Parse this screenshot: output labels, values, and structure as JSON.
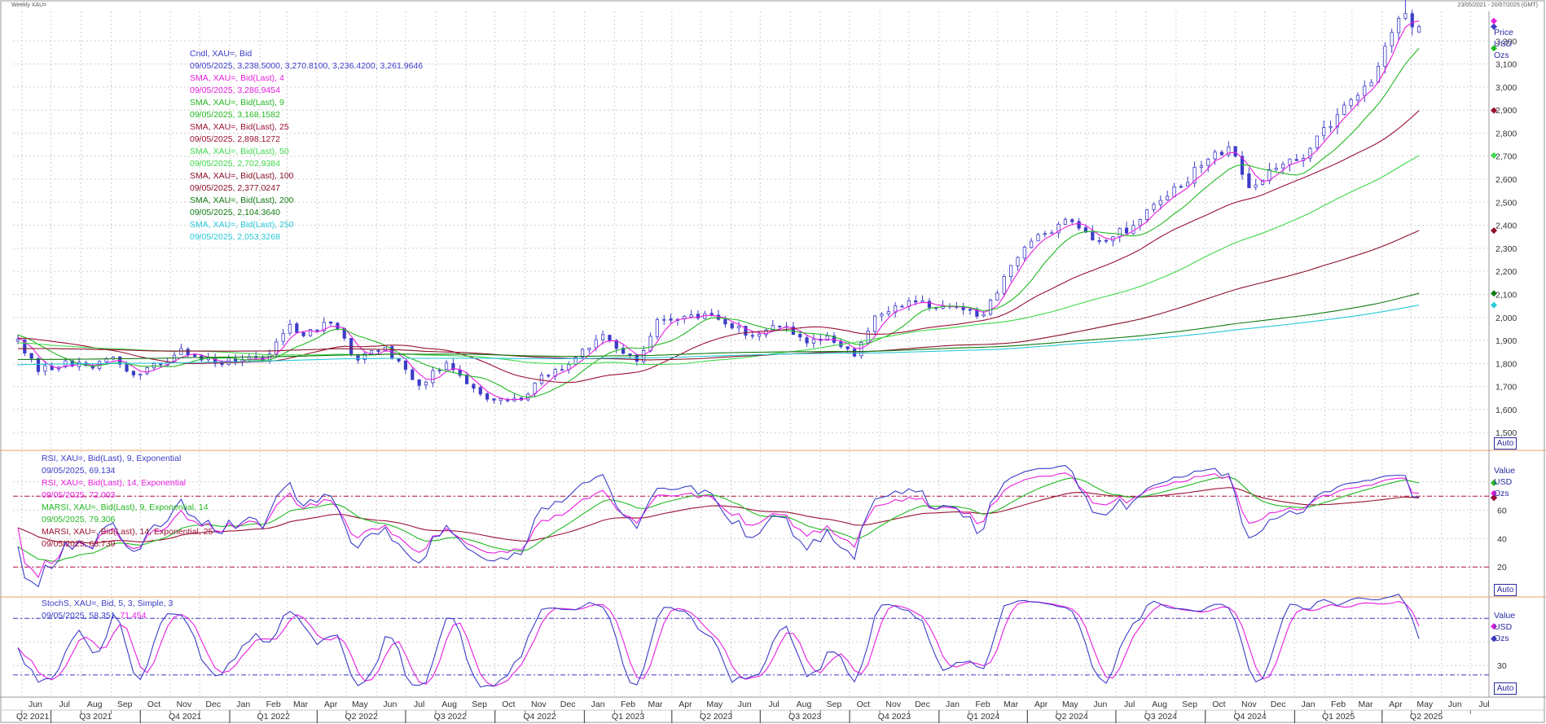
{
  "header": {
    "title": "Weekly XAU=",
    "range": "23/05/2021 - 20/07/2025 (GMT)"
  },
  "price_legend": [
    {
      "text": "Cndl, XAU=, Bid",
      "color": "#3c3cc8"
    },
    {
      "text": "09/05/2025, 3,238.5000, 3,270.8100, 3,236.4200, 3,261.9646",
      "color": "#3c3cc8"
    },
    {
      "text": "SMA, XAU=, Bid(Last),  4",
      "color": "#e81ee0"
    },
    {
      "text": "09/05/2025, 3,286.9454",
      "color": "#e81ee0"
    },
    {
      "text": "SMA, XAU=, Bid(Last),  9",
      "color": "#22b922"
    },
    {
      "text": "09/05/2025, 3,168.1582",
      "color": "#22b922"
    },
    {
      "text": "SMA, XAU=, Bid(Last),  25",
      "color": "#9a1232"
    },
    {
      "text": "09/05/2025, 2,898.1272",
      "color": "#9a1232"
    },
    {
      "text": "SMA, XAU=, Bid(Last),  50",
      "color": "#3fd84a"
    },
    {
      "text": "09/05/2025, 2,702.9384",
      "color": "#3fd84a"
    },
    {
      "text": "SMA, XAU=, Bid(Last),  100",
      "color": "#8a0f28"
    },
    {
      "text": "09/05/2025, 2,377.0247",
      "color": "#8a0f28"
    },
    {
      "text": "SMA, XAU=, Bid(Last),  200",
      "color": "#117a11"
    },
    {
      "text": "09/05/2025, 2,104.3640",
      "color": "#117a11"
    },
    {
      "text": "SMA, XAU=, Bid(Last),  250",
      "color": "#27c8d8"
    },
    {
      "text": "09/05/2025, 2,053.3268",
      "color": "#27c8d8"
    }
  ],
  "rsi_legend": [
    {
      "text": "RSI, XAU=, Bid(Last),  9, Exponential",
      "color": "#3c3cc8"
    },
    {
      "text": "09/05/2025, 69.134",
      "color": "#3c3cc8"
    },
    {
      "text": "RSI, XAU=, Bid(Last),  14, Exponential",
      "color": "#e81ee0"
    },
    {
      "text": "09/05/2025, 72.003",
      "color": "#e81ee0"
    },
    {
      "text": "MARSI, XAU=, Bid(Last),  9, Exponential, 14",
      "color": "#22b922"
    },
    {
      "text": "09/05/2025, 79.306",
      "color": "#22b922"
    },
    {
      "text": "MARSI, XAU=, Bid(Last),  14, Exponential, 25",
      "color": "#9a1232"
    },
    {
      "text": "09/05/2025, 68.739",
      "color": "#9a1232"
    }
  ],
  "stoch_legend": [
    {
      "text": "StochS, XAU=, Bid,  5, 3, Simple, 3",
      "color": "#3c3cc8"
    },
    {
      "text_a": "09/05/2025, 58.351,",
      "text_b": " 71.454",
      "color_a": "#3c3cc8",
      "color_b": "#e81ee0"
    }
  ],
  "price_axis": {
    "title_lines": [
      "Price",
      "USD",
      "Ozs"
    ],
    "auto": "Auto",
    "ticks": [
      "1,500",
      "1,600",
      "1,700",
      "1,800",
      "1,900",
      "2,000",
      "2,100",
      "2,200",
      "2,300",
      "2,400",
      "2,500",
      "2,600",
      "2,700",
      "2,800",
      "2,900",
      "3,000",
      "3,100",
      "3,200"
    ]
  },
  "rsi_axis": {
    "title_lines": [
      "Value",
      "USD",
      "Ozs"
    ],
    "auto": "Auto",
    "ticks": [
      "20",
      "40",
      "60"
    ]
  },
  "stoch_axis": {
    "title_lines": [
      "Value",
      "USD",
      "Ozs"
    ],
    "auto": "Auto",
    "ticks": [
      "30"
    ]
  },
  "time_axis": {
    "months": [
      "Jun",
      "Jul",
      "Aug",
      "Sep",
      "Oct",
      "Nov",
      "Dec",
      "Jan",
      "Feb",
      "Mar",
      "Apr",
      "May",
      "Jun",
      "Jul",
      "Aug",
      "Sep",
      "Oct",
      "Nov",
      "Dec",
      "Jan",
      "Feb",
      "Mar",
      "Apr",
      "May",
      "Jun",
      "Jul",
      "Aug",
      "Sep",
      "Oct",
      "Nov",
      "Dec",
      "Jan",
      "Feb",
      "Mar",
      "Apr",
      "May",
      "Jun",
      "Jul",
      "Aug",
      "Sep",
      "Oct",
      "Nov",
      "Dec",
      "Jan",
      "Feb",
      "Mar",
      "Apr",
      "May",
      "Jun",
      "Jul"
    ],
    "quarters": [
      "Q2 2021",
      "Q3 2021",
      "Q4 2021",
      "Q1 2022",
      "Q2 2022",
      "Q3 2022",
      "Q4 2022",
      "Q1 2023",
      "Q2 2023",
      "Q3 2023",
      "Q4 2023",
      "Q1 2024",
      "Q2 2024",
      "Q3 2024",
      "Q4 2024",
      "Q1 2025",
      "Q2 2025"
    ]
  },
  "colors": {
    "up": "#3c3cc8",
    "down": "#3c3cc8",
    "sma4": "#e81ee0",
    "sma9": "#22b922",
    "sma25": "#9a1232",
    "sma50": "#3fd84a",
    "sma100": "#8a0f28",
    "sma200": "#117a11",
    "sma250": "#27c8d8",
    "ob_line": "#b0123a",
    "os_line": "#b0123a",
    "stoch_k": "#3c3cc8",
    "stoch_d": "#e81ee0"
  },
  "chart_data": [
    {
      "type": "candlestick",
      "title": "Weekly XAU=",
      "ylabel": "Price USD Ozs",
      "ylim": [
        1430,
        3300
      ],
      "start_date": "2021-05-28",
      "interval": "weekly",
      "close_anchors": [
        [
          "2021-05-28",
          1905
        ],
        [
          "2021-06-18",
          1765
        ],
        [
          "2021-07-16",
          1812
        ],
        [
          "2021-08-13",
          1780
        ],
        [
          "2021-09-03",
          1828
        ],
        [
          "2021-09-24",
          1750
        ],
        [
          "2021-10-22",
          1795
        ],
        [
          "2021-11-12",
          1865
        ],
        [
          "2021-12-17",
          1800
        ],
        [
          "2022-01-14",
          1818
        ],
        [
          "2022-02-04",
          1808
        ],
        [
          "2022-03-04",
          1970
        ],
        [
          "2022-03-18",
          1920
        ],
        [
          "2022-04-15",
          1975
        ],
        [
          "2022-05-13",
          1815
        ],
        [
          "2022-06-10",
          1871
        ],
        [
          "2022-07-15",
          1705
        ],
        [
          "2022-08-12",
          1802
        ],
        [
          "2022-09-02",
          1712
        ],
        [
          "2022-09-23",
          1645
        ],
        [
          "2022-10-28",
          1642
        ],
        [
          "2022-11-18",
          1750
        ],
        [
          "2022-12-16",
          1795
        ],
        [
          "2023-01-20",
          1925
        ],
        [
          "2023-02-24",
          1810
        ],
        [
          "2023-03-17",
          1990
        ],
        [
          "2023-04-14",
          2005
        ],
        [
          "2023-05-05",
          2016
        ],
        [
          "2023-06-23",
          1920
        ],
        [
          "2023-07-21",
          1962
        ],
        [
          "2023-08-18",
          1889
        ],
        [
          "2023-09-08",
          1920
        ],
        [
          "2023-10-06",
          1832
        ],
        [
          "2023-10-27",
          2006
        ],
        [
          "2023-12-01",
          2072
        ],
        [
          "2024-01-12",
          2049
        ],
        [
          "2024-02-16",
          2013
        ],
        [
          "2024-03-08",
          2178
        ],
        [
          "2024-04-12",
          2360
        ],
        [
          "2024-05-17",
          2415
        ],
        [
          "2024-06-14",
          2333
        ],
        [
          "2024-07-19",
          2400
        ],
        [
          "2024-08-16",
          2508
        ],
        [
          "2024-09-27",
          2658
        ],
        [
          "2024-10-25",
          2740
        ],
        [
          "2024-11-15",
          2563
        ],
        [
          "2024-12-13",
          2648
        ],
        [
          "2025-01-10",
          2690
        ],
        [
          "2025-02-14",
          2880
        ],
        [
          "2025-03-21",
          3020
        ],
        [
          "2025-04-11",
          3237
        ],
        [
          "2025-04-25",
          3319
        ],
        [
          "2025-05-09",
          3262
        ]
      ],
      "last_candle": {
        "date": "2025-05-09",
        "open": 3238.5,
        "high": 3270.81,
        "low": 3236.42,
        "close": 3261.9646
      },
      "series": [
        {
          "name": "SMA 4",
          "last": 3286.9454
        },
        {
          "name": "SMA 9",
          "last": 3168.1582
        },
        {
          "name": "SMA 25",
          "last": 2898.1272
        },
        {
          "name": "SMA 50",
          "last": 2702.9384
        },
        {
          "name": "SMA 100",
          "last": 2377.0247
        },
        {
          "name": "SMA 200",
          "last": 2104.364
        },
        {
          "name": "SMA 250",
          "last": 2053.3268
        }
      ]
    },
    {
      "type": "line",
      "title": "RSI",
      "ylim": [
        0,
        100
      ],
      "levels": {
        "overbought": 70,
        "oversold": 20
      },
      "series": [
        {
          "name": "RSI 9",
          "last": 69.134
        },
        {
          "name": "RSI 14",
          "last": 72.003
        },
        {
          "name": "MARSI 9",
          "last": 79.306
        },
        {
          "name": "MARSI 14",
          "last": 68.739
        }
      ]
    },
    {
      "type": "line",
      "title": "StochS",
      "ylim": [
        0,
        100
      ],
      "levels": {
        "upper": 80,
        "lower": 20
      },
      "series": [
        {
          "name": "%K",
          "last": 58.351
        },
        {
          "name": "%D",
          "last": 71.454
        }
      ]
    }
  ]
}
